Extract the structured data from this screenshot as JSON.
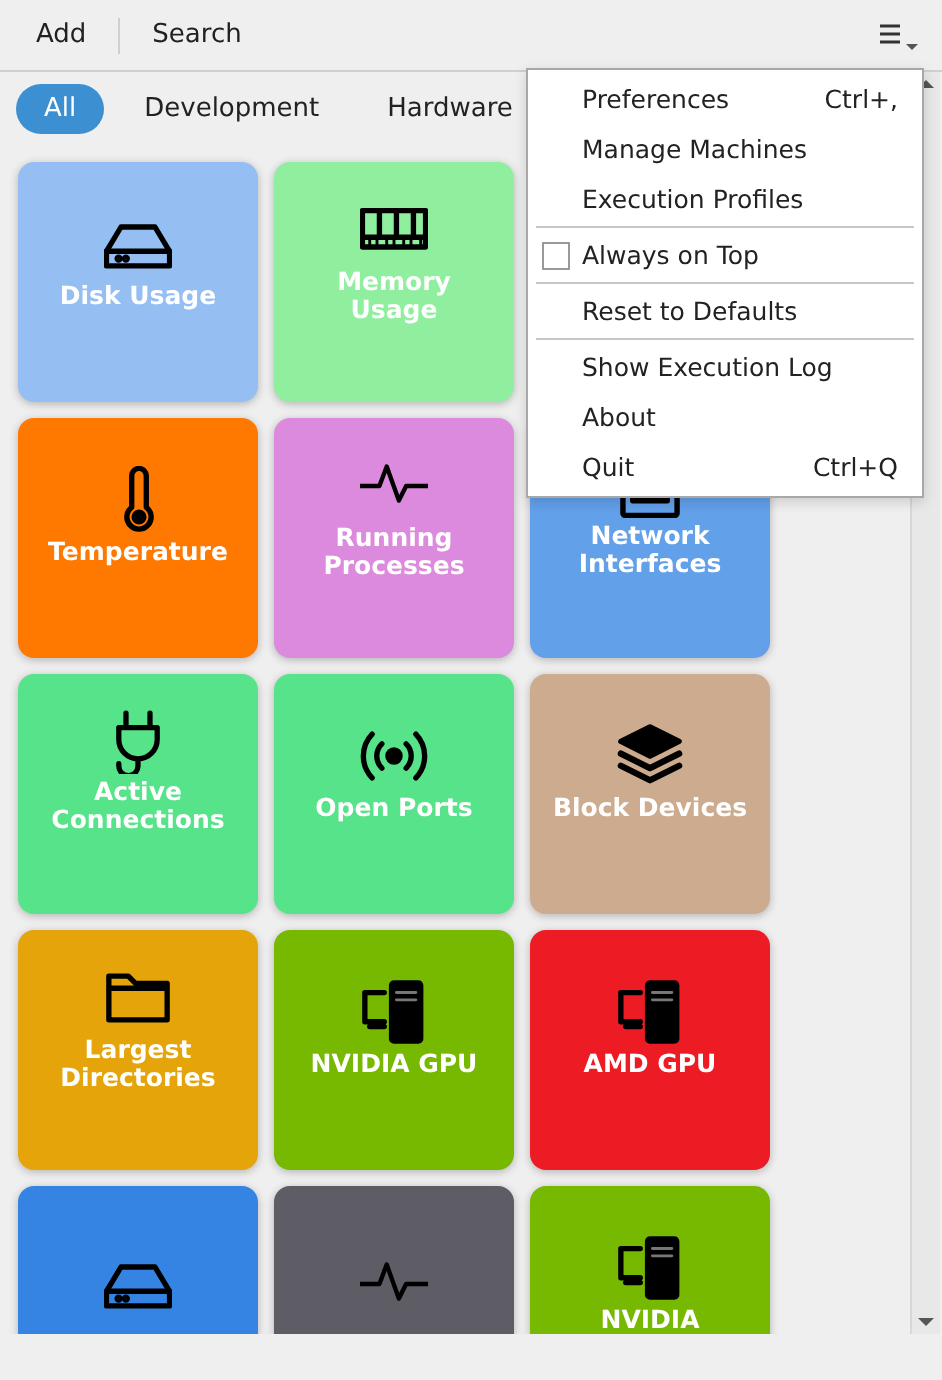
{
  "toolbar": {
    "buttons": [
      "Add",
      "Search"
    ]
  },
  "filters": [
    {
      "label": "All",
      "selected": true
    },
    {
      "label": "Development",
      "selected": false
    },
    {
      "label": "Hardware",
      "selected": false
    }
  ],
  "tiles": [
    {
      "label": "Disk Usage",
      "kind": "disk",
      "color": "#95bff2"
    },
    {
      "label": "Memory Usage",
      "kind": "memory",
      "color": "#90ee9f"
    },
    {
      "kind": "covered"
    },
    {
      "label": "Temperature",
      "kind": "thermometer",
      "color": "#ff7800"
    },
    {
      "label": "Running Processes",
      "kind": "pulse",
      "color": "#dc8add"
    },
    {
      "label": "Network Interfaces",
      "kind": "ethernet",
      "color": "#62a0ea"
    },
    {
      "label": "Active Connections",
      "kind": "plug",
      "color": "#57e389"
    },
    {
      "label": "Open Ports",
      "kind": "broadcast",
      "color": "#57e389"
    },
    {
      "label": "Block Devices",
      "kind": "layers",
      "color": "#cdab8f"
    },
    {
      "label": "Largest Directories",
      "kind": "folder",
      "color": "#e5a50a"
    },
    {
      "label": "NVIDIA GPU",
      "kind": "computer",
      "color": "#76b900"
    },
    {
      "label": "AMD GPU",
      "kind": "computer",
      "color": "#ed1c24"
    },
    {
      "kind": "disk",
      "color": "#3584e4"
    },
    {
      "kind": "pulse",
      "color": "#5e5c64"
    },
    {
      "label": "NVIDIA",
      "kind": "computer",
      "color": "#76b900"
    }
  ],
  "menu": {
    "sections": [
      [
        {
          "kind": "item",
          "label": "Preferences",
          "shortcut": "Ctrl+,"
        },
        {
          "kind": "item",
          "label": "Manage Machines"
        },
        {
          "kind": "item",
          "label": "Execution Profiles"
        }
      ],
      [
        {
          "kind": "check",
          "label": "Always on Top",
          "checked": false
        }
      ],
      [
        {
          "kind": "item",
          "label": "Reset to Defaults"
        }
      ],
      [
        {
          "kind": "item",
          "label": "Show Execution Log"
        },
        {
          "kind": "item",
          "label": "About"
        },
        {
          "kind": "item",
          "label": "Quit",
          "shortcut": "Ctrl+Q"
        }
      ]
    ]
  }
}
